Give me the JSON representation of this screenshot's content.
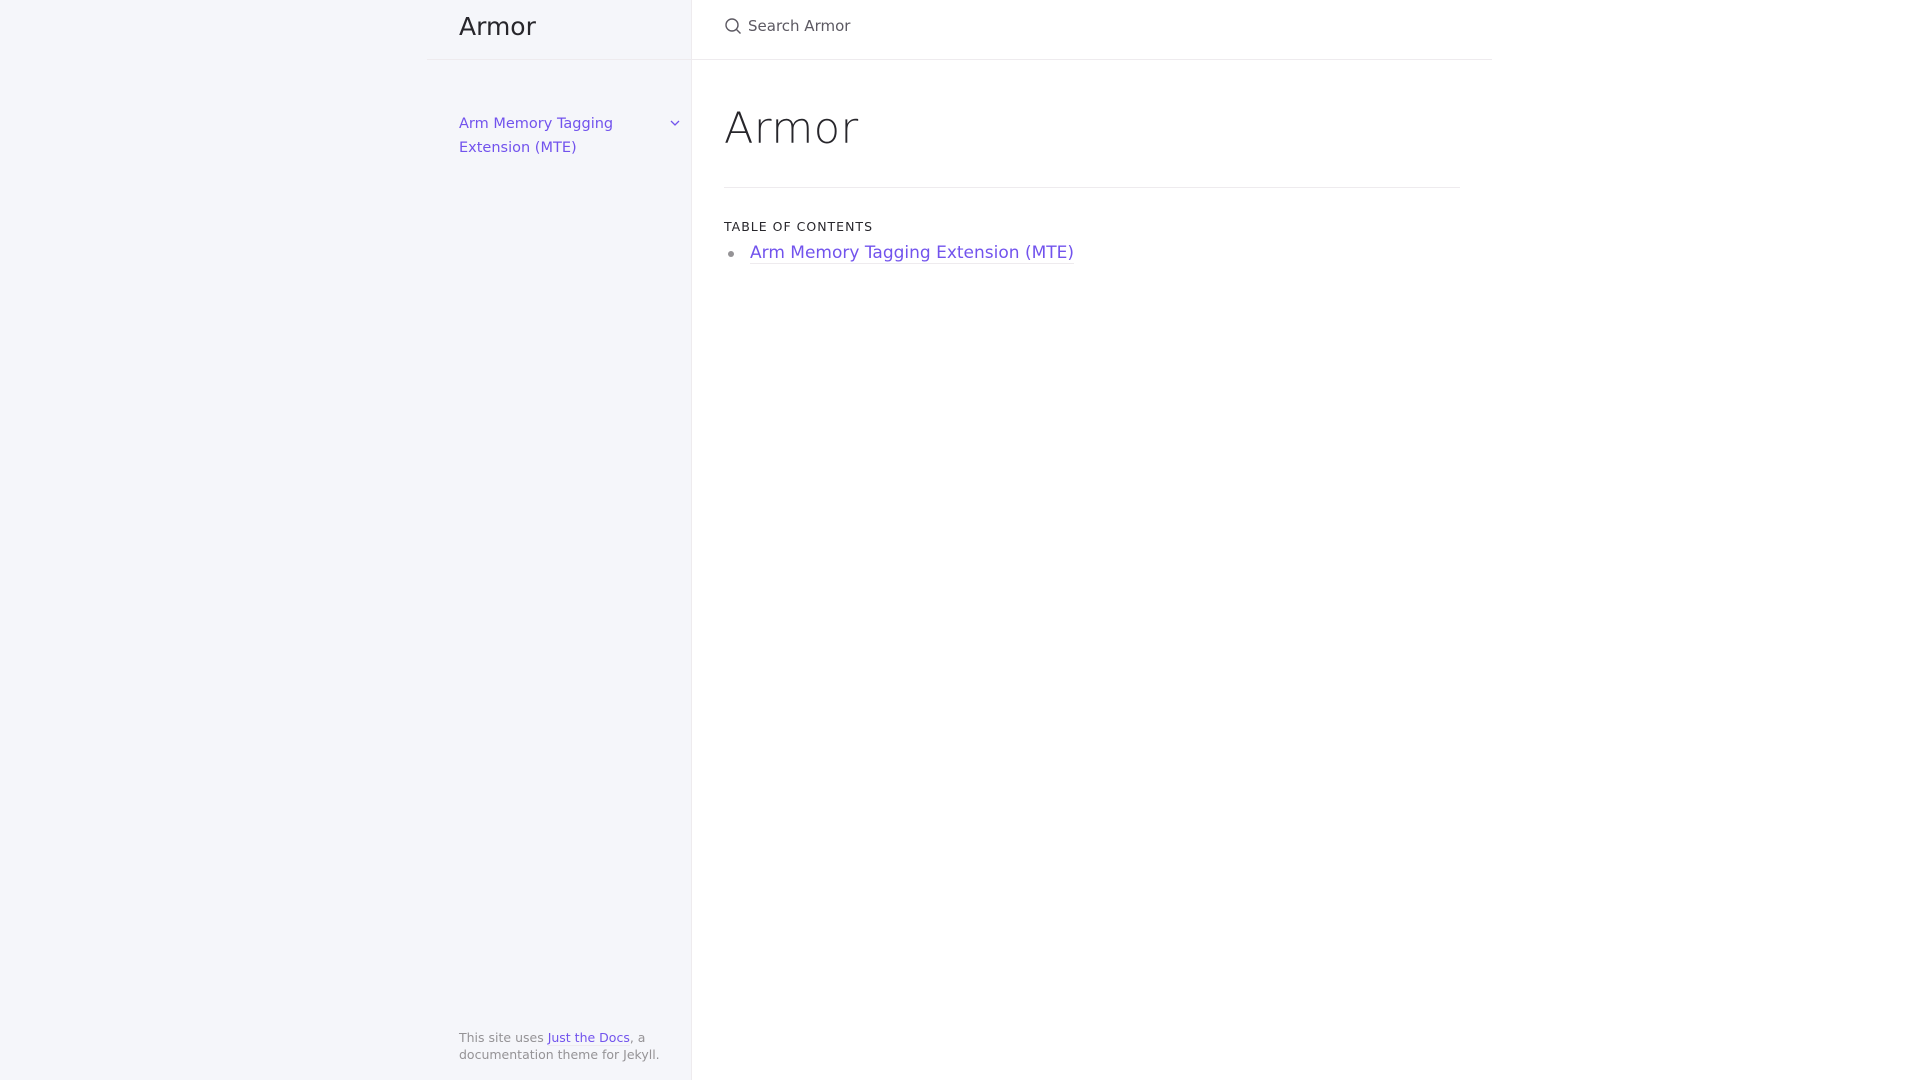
{
  "site": {
    "title": "Armor"
  },
  "search": {
    "placeholder": "Search Armor"
  },
  "sidebar": {
    "items": [
      {
        "label": "Arm Memory Tagging Extension (MTE)"
      }
    ],
    "footer": {
      "prefix": "This site uses ",
      "link": "Just the Docs",
      "suffix": ", a documentation theme for Jekyll."
    }
  },
  "main": {
    "title": "Armor",
    "toc_label": "TABLE OF CONTENTS",
    "toc": [
      {
        "label": "Arm Memory Tagging Extension (MTE)"
      }
    ]
  },
  "colors": {
    "accent": "#7253ed",
    "sidebar_bg": "#f5f6fa"
  }
}
